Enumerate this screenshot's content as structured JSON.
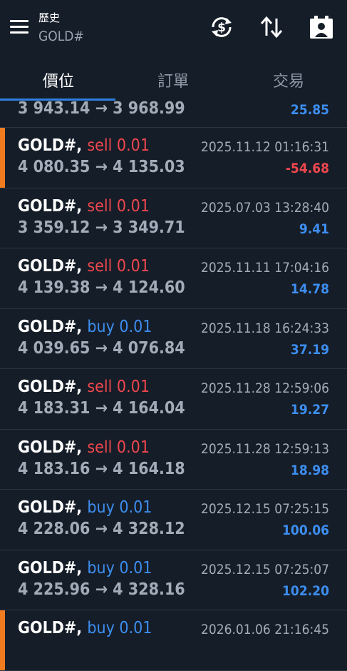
{
  "header": {
    "title": "歷史",
    "subtitle": "GOLD#",
    "icons": [
      "menu-icon",
      "currency-sync-icon",
      "sort-arrows-icon",
      "calendar-person-icon"
    ]
  },
  "tabs": [
    {
      "label": "價位",
      "active": true
    },
    {
      "label": "訂單",
      "active": false
    },
    {
      "label": "交易",
      "active": false
    }
  ],
  "colors": {
    "buy": "#3d8ef0",
    "sell": "#f0474e",
    "accent": "#2f7fe0",
    "marker": "#f07c1f",
    "background": "#151d28"
  },
  "partial_row": {
    "prices": "3 943.14 → 3 968.99",
    "profit": "25.85"
  },
  "trades": [
    {
      "symbol": "GOLD#,",
      "side": "sell 0.01",
      "time": "2025.11.12 01:16:31",
      "prices": "4 080.35 → 4 135.03",
      "profit": "-54.68",
      "marked": true
    },
    {
      "symbol": "GOLD#,",
      "side": "sell 0.01",
      "time": "2025.07.03 13:28:40",
      "prices": "3 359.12 → 3 349.71",
      "profit": "9.41",
      "marked": false
    },
    {
      "symbol": "GOLD#,",
      "side": "sell 0.01",
      "time": "2025.11.11 17:04:16",
      "prices": "4 139.38 → 4 124.60",
      "profit": "14.78",
      "marked": false
    },
    {
      "symbol": "GOLD#,",
      "side": "buy 0.01",
      "time": "2025.11.18 16:24:33",
      "prices": "4 039.65 → 4 076.84",
      "profit": "37.19",
      "marked": false
    },
    {
      "symbol": "GOLD#,",
      "side": "sell 0.01",
      "time": "2025.11.28 12:59:06",
      "prices": "4 183.31 → 4 164.04",
      "profit": "19.27",
      "marked": false
    },
    {
      "symbol": "GOLD#,",
      "side": "sell 0.01",
      "time": "2025.11.28 12:59:13",
      "prices": "4 183.16 → 4 164.18",
      "profit": "18.98",
      "marked": false
    },
    {
      "symbol": "GOLD#,",
      "side": "buy 0.01",
      "time": "2025.12.15 07:25:15",
      "prices": "4 228.06 → 4 328.12",
      "profit": "100.06",
      "marked": false
    },
    {
      "symbol": "GOLD#,",
      "side": "buy 0.01",
      "time": "2025.12.15 07:25:07",
      "prices": "4 225.96 → 4 328.16",
      "profit": "102.20",
      "marked": false
    },
    {
      "symbol": "GOLD#,",
      "side": "buy 0.01",
      "time": "2026.01.06 21:16:45",
      "prices": "",
      "profit": "",
      "marked": true
    }
  ]
}
